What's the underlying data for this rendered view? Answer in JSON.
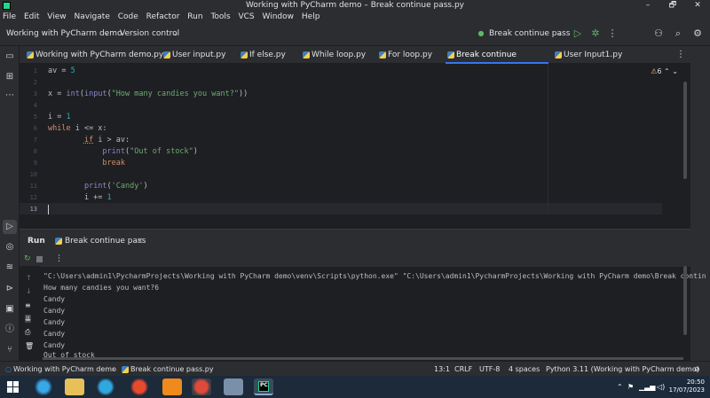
{
  "window": {
    "title": "Working with PyCharm demo – Break continue pass.py",
    "minimize": "–",
    "maximize": "🗗",
    "close": "✕"
  },
  "menu": [
    "File",
    "Edit",
    "View",
    "Navigate",
    "Code",
    "Refactor",
    "Run",
    "Tools",
    "VCS",
    "Window",
    "Help"
  ],
  "toolbar": {
    "project": "Working with PyCharm demo",
    "vcs": "Version control",
    "run_config": "Break continue pass"
  },
  "tabs": [
    "Working with PyCharm demo.py",
    "User input.py",
    "If else.py",
    "While loop.py",
    "For loop.py",
    "Break continue pass.py",
    "User Input1.py"
  ],
  "active_tab": "Break continue pass.py",
  "editor": {
    "warnings": "6"
  },
  "code_lines": [
    {
      "n": "1"
    },
    {
      "n": "2"
    },
    {
      "n": "3"
    },
    {
      "n": "4"
    },
    {
      "n": "5"
    },
    {
      "n": "6"
    },
    {
      "n": "7"
    },
    {
      "n": "8"
    },
    {
      "n": "9"
    },
    {
      "n": "10"
    },
    {
      "n": "11"
    },
    {
      "n": "12"
    },
    {
      "n": "13"
    }
  ],
  "run": {
    "label": "Run",
    "tab": "Break continue pass"
  },
  "output": [
    "\"C:\\Users\\admin1\\PycharmProjects\\Working with PyCharm demo\\venv\\Scripts\\python.exe\" \"C:\\Users\\admin1\\PycharmProjects\\Working with PyCharm demo\\Break contin",
    "How many candies you want?6",
    "Candy",
    "Candy",
    "Candy",
    "Candy",
    "Candy",
    "Out of stock"
  ],
  "status": {
    "breadcrumb_project": "Working with PyCharm demo",
    "breadcrumb_file": "Break continue pass.py",
    "position": "13:1",
    "line_sep": "CRLF",
    "encoding": "UTF-8",
    "indent": "4 spaces",
    "interpreter": "Python 3.11 (Working with PyCharm demo)"
  },
  "clock": {
    "time": "20:50",
    "date": "17/07/2023"
  }
}
